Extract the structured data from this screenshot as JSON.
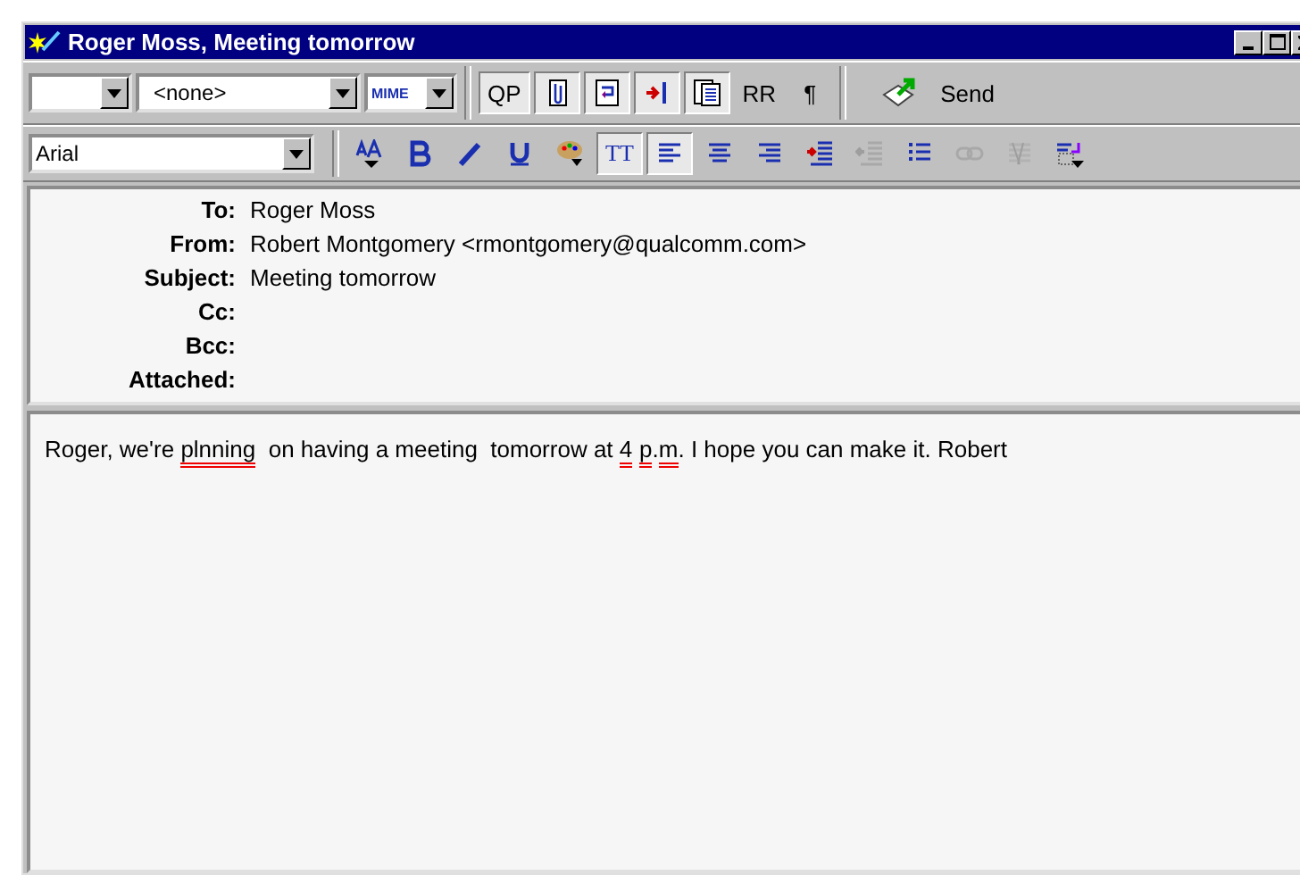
{
  "window": {
    "title": "Roger Moss, Meeting tomorrow"
  },
  "toolbar_1": [
    {
      "kind": "dropdown-empty"
    },
    {
      "kind": "dropdown",
      "value": "<none>"
    },
    {
      "kind": "dropdown-mime",
      "value": "MIME"
    },
    {
      "kind": "text-button",
      "label": "QP",
      "pressed": true
    },
    {
      "kind": "icon-button",
      "pressed": true
    },
    {
      "kind": "icon-button",
      "pressed": true
    },
    {
      "kind": "icon-button",
      "pressed": true
    },
    {
      "kind": "icon-button",
      "pressed": true
    },
    {
      "kind": "text-button",
      "label": "RR",
      "pressed": false
    },
    {
      "kind": "text-button",
      "label": "¶",
      "pressed": false
    },
    {
      "kind": "send-button",
      "label": "Send"
    }
  ],
  "toolbar_2": [
    {
      "kind": "font-dropdown",
      "value": "Arial"
    },
    {
      "kind": "icon-button",
      "pressed": false,
      "disabled": false
    },
    {
      "kind": "icon-button",
      "pressed": false,
      "disabled": false
    },
    {
      "kind": "icon-button",
      "pressed": false,
      "disabled": false
    },
    {
      "kind": "icon-button",
      "pressed": false,
      "disabled": false
    },
    {
      "kind": "icon-button",
      "pressed": false,
      "disabled": false
    },
    {
      "kind": "text-button",
      "label": "TT",
      "pressed": true
    },
    {
      "kind": "icon-button",
      "pressed": true,
      "disabled": false
    },
    {
      "kind": "icon-button",
      "pressed": false,
      "disabled": false
    },
    {
      "kind": "icon-button",
      "pressed": false,
      "disabled": false
    },
    {
      "kind": "icon-button",
      "pressed": false,
      "disabled": false
    },
    {
      "kind": "icon-button",
      "pressed": false,
      "disabled": true
    },
    {
      "kind": "icon-button",
      "pressed": false,
      "disabled": false
    },
    {
      "kind": "icon-button",
      "pressed": false,
      "disabled": true
    },
    {
      "kind": "icon-button",
      "pressed": false,
      "disabled": true
    },
    {
      "kind": "icon-button",
      "pressed": false,
      "disabled": false
    }
  ],
  "header_fields": [
    {
      "label": "To:",
      "value": "Roger Moss"
    },
    {
      "label": "From:",
      "value": "Robert Montgomery <rmontgomery@qualcomm.com>"
    },
    {
      "label": "Subject:",
      "value": "Meeting tomorrow"
    },
    {
      "label": "Cc:"
    },
    {
      "label": "Bcc:"
    },
    {
      "label": "Attached:"
    }
  ],
  "message_body": [
    {
      "text": "Roger, we're ",
      "misspelled": false
    },
    {
      "text": "plnning",
      "misspelled": true
    },
    {
      "text": "  on having a meeting  tomorrow at ",
      "misspelled": false
    },
    {
      "text": "4",
      "misspelled": true,
      "space_after": true
    },
    {
      "text": "p",
      "misspelled": true
    },
    {
      "text": ".",
      "misspelled": false
    },
    {
      "text": "m",
      "misspelled": true
    },
    {
      "text": ". I hope you can make it. Robert",
      "misspelled": false
    }
  ]
}
